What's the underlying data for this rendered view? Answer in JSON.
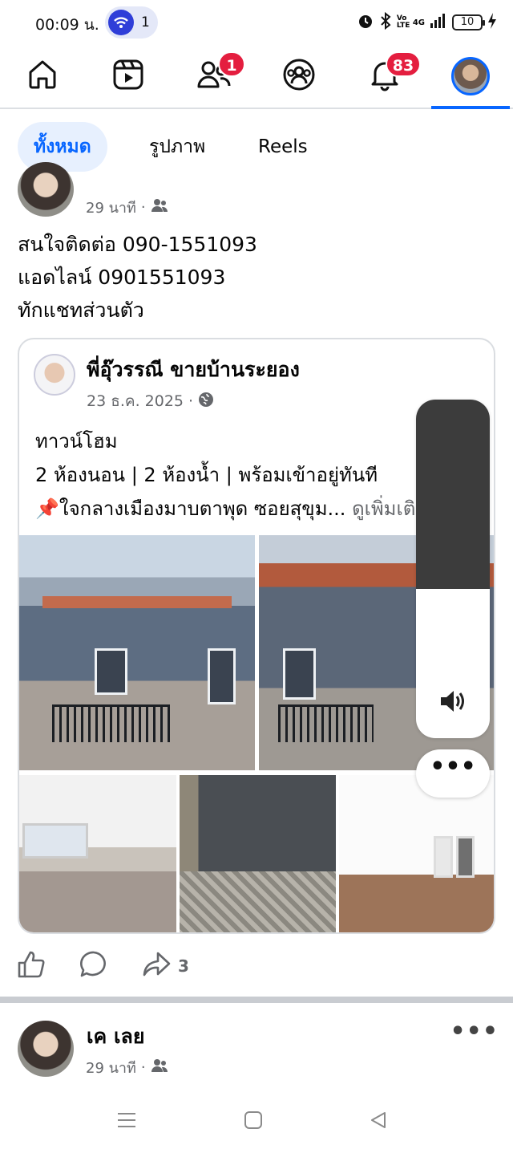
{
  "status_bar": {
    "time": "00:09 น.",
    "notification_count": "1",
    "battery": "10",
    "signal_label": "4G",
    "volte_label": "Vo LTE"
  },
  "top_nav": {
    "items": [
      {
        "name": "home",
        "icon": "home-icon"
      },
      {
        "name": "video",
        "icon": "video-icon"
      },
      {
        "name": "friends",
        "icon": "friends-icon",
        "badge": "1"
      },
      {
        "name": "groups",
        "icon": "groups-icon"
      },
      {
        "name": "notifications",
        "icon": "bell-icon",
        "badge": "83"
      },
      {
        "name": "profile",
        "icon": "avatar",
        "active": true
      }
    ]
  },
  "tabs": {
    "all": "ทั้งหมด",
    "photos": "รูปภาพ",
    "reels": "Reels",
    "active": "all"
  },
  "post": {
    "time": "29 นาที",
    "separator": "·",
    "audience_icon": "friends-icon",
    "text_lines": [
      "สนใจติดต่อ 090-1551093",
      "แอดไลน์ 0901551093",
      "ทักแชทส่วนตัว"
    ]
  },
  "shared_post": {
    "author": "พี่อุ๊วรรณี ขายบ้านระยอง",
    "date": "23 ธ.ค. 2025",
    "separator": "·",
    "audience_icon": "globe-icon",
    "body_lines": [
      "ทาวน์โฮม",
      "2 ห้องนอน | 2 ห้องน้ำ | พร้อมเข้าอยู่ทันที",
      "📌ใจกลางเมืองมาบตาพุด ซอยสุขุม..."
    ],
    "see_more": "ดูเพิ่มเติม"
  },
  "floating_panel": {
    "volume_fraction": 0.56,
    "volume_icon": "speaker-icon",
    "more_label": "•••"
  },
  "actions": {
    "like_icon": "like-icon",
    "comment_icon": "comment-icon",
    "share_icon": "share-icon",
    "share_count": "3"
  },
  "next_post": {
    "author": "เค เลย",
    "time": "29 นาที",
    "separator": "·",
    "more_label": "•••"
  },
  "colors": {
    "accent": "#0866ff",
    "badge": "#e41e3f",
    "muted": "#65676b"
  }
}
